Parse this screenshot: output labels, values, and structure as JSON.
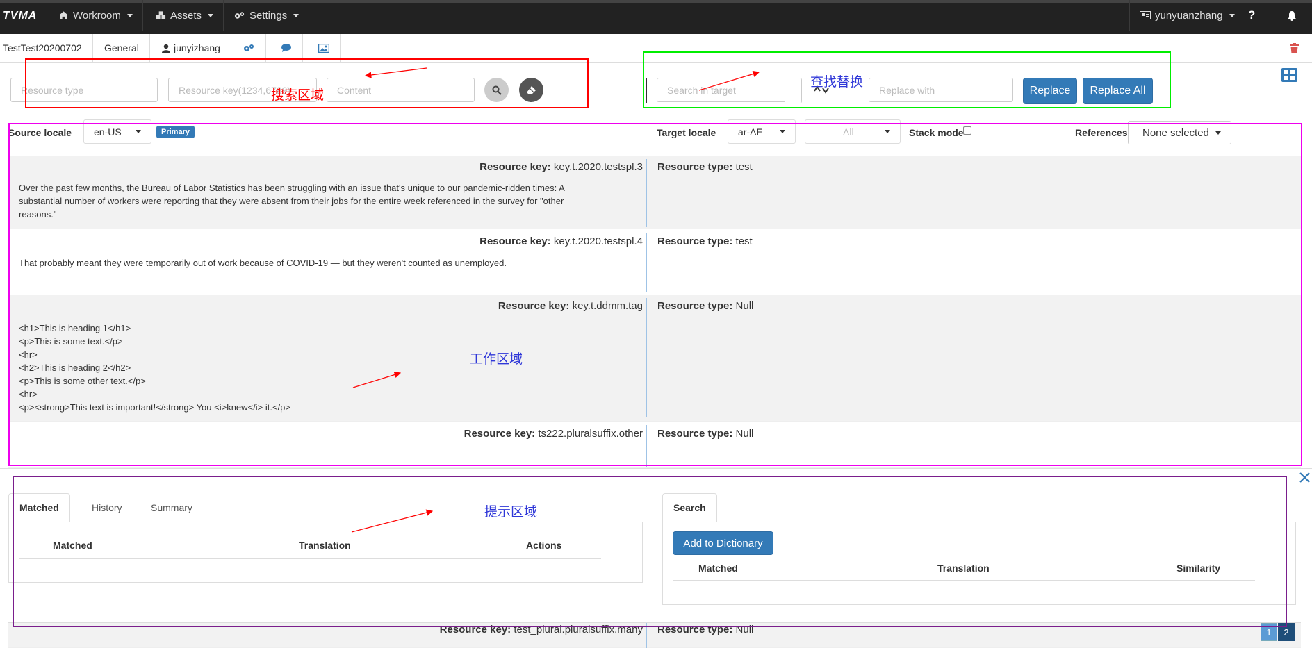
{
  "app": {
    "brand": "TVMA"
  },
  "nav": [
    {
      "label": "Workroom",
      "icon": "home-icon"
    },
    {
      "label": "Assets",
      "icon": "cubes-icon"
    },
    {
      "label": "Settings",
      "icon": "gears-icon"
    }
  ],
  "user": {
    "name": "yunyuanzhang",
    "help": "?"
  },
  "project": {
    "name": "TestTest20200702",
    "category": "General",
    "owner": "junyizhang"
  },
  "search": {
    "resource_type_placeholder": "Resource type",
    "resource_key_placeholder": "Resource key(1234,6789)",
    "content_placeholder": "Content"
  },
  "find_replace": {
    "search_placeholder": "Search in target",
    "replace_placeholder": "Replace with",
    "replace_label": "Replace",
    "replace_all_label": "Replace All"
  },
  "locale_bar": {
    "source_label": "Source locale",
    "source_value": "en-US",
    "primary_badge": "Primary",
    "target_label": "Target locale",
    "target_value": "ar-AE",
    "filter_value": "All",
    "stack_mode_label": "Stack mode",
    "references_label": "References",
    "references_value": "None selected"
  },
  "rows": [
    {
      "key_label": "Resource key:",
      "key": "key.t.2020.testspl.3",
      "type_label": "Resource type:",
      "type": "test",
      "text": [
        "Over the past few months, the Bureau of Labor Statistics has been struggling with an issue that's unique to our pandemic-ridden times: A",
        "substantial number of workers were reporting that they were absent from their jobs for the entire week referenced in the survey for \"other",
        "reasons.\""
      ]
    },
    {
      "key_label": "Resource key:",
      "key": "key.t.2020.testspl.4",
      "type_label": "Resource type:",
      "type": "test",
      "text": [
        "That probably meant they were temporarily out of work because of COVID-19 — but they weren't counted as unemployed."
      ]
    },
    {
      "key_label": "Resource key:",
      "key": "key.t.ddmm.tag",
      "type_label": "Resource type:",
      "type": "Null",
      "text": [
        "<h1>This is heading 1</h1>",
        "<p>This is some text.</p>",
        "<hr>",
        "<h2>This is heading 2</h2>",
        "<p>This is some other text.</p>",
        "<hr>",
        "<p><strong>This text is important!</strong> You <i>knew</i> it.</p>"
      ]
    },
    {
      "key_label": "Resource key:",
      "key": "ts222.pluralsuffix.other",
      "type_label": "Resource type:",
      "type": "Null",
      "text": []
    },
    {
      "key_label": "Resource key:",
      "key": "test_plural.pluralsuffix.many",
      "type_label": "Resource type:",
      "type": "Null",
      "text": []
    }
  ],
  "hints": {
    "tabs": [
      "Matched",
      "History",
      "Summary"
    ],
    "columns": [
      "Matched",
      "Translation",
      "Actions"
    ],
    "search_tab": "Search",
    "add_dictionary_label": "Add to Dictionary",
    "search_columns": [
      "Matched",
      "Translation",
      "Similarity"
    ]
  },
  "pagination": [
    "1",
    "2"
  ],
  "annotations": {
    "search_area": "搜索区域",
    "find_replace": "查找替换",
    "work_area": "工作区域",
    "hint_area": "提示区域"
  },
  "colors": {
    "accent": "#337ab7",
    "annotation_red": "#ff0000",
    "annotation_green": "#00ee00",
    "annotation_magenta": "#ee00ee",
    "annotation_purple": "#7a1e8c"
  }
}
